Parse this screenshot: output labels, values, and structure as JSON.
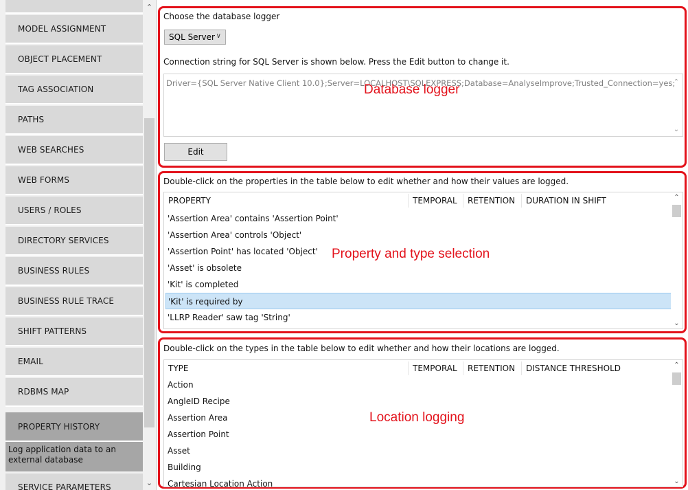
{
  "nav": {
    "items": [
      {
        "label": "MODEL ASSIGNMENT"
      },
      {
        "label": "OBJECT PLACEMENT"
      },
      {
        "label": "TAG ASSOCIATION"
      },
      {
        "label": "PATHS"
      },
      {
        "label": "WEB SEARCHES"
      },
      {
        "label": "WEB FORMS"
      },
      {
        "label": "USERS / ROLES"
      },
      {
        "label": "DIRECTORY SERVICES"
      },
      {
        "label": "BUSINESS RULES"
      },
      {
        "label": "BUSINESS RULE TRACE"
      },
      {
        "label": "SHIFT PATTERNS"
      },
      {
        "label": "EMAIL"
      },
      {
        "label": "RDBMS MAP"
      },
      {
        "label": "PROPERTY HISTORY"
      },
      {
        "label": "SERVICE PARAMETERS"
      }
    ],
    "active_index": 13,
    "active_description": "Log application data to an external database"
  },
  "logger": {
    "heading": "Choose the database logger",
    "selected": "SQL Server",
    "info": "Connection string for SQL Server is shown below. Press the Edit button to change it.",
    "connection_string": "Driver={SQL Server Native Client 10.0};Server=LOCALHOST\\SQLEXPRESS;Database=AnalyseImprove;Trusted_Connection=yes;",
    "edit_label": "Edit",
    "annotation": "Database  logger"
  },
  "properties": {
    "heading": "Double-click on the properties in the table below to edit whether and how their values are logged.",
    "columns": [
      "PROPERTY",
      "TEMPORAL",
      "RETENTION",
      "DURATION IN SHIFT"
    ],
    "rows": [
      "'Assertion Area' contains 'Assertion Point'",
      "'Assertion Area' controls 'Object'",
      "'Assertion Point' has located 'Object'",
      "'Asset' is obsolete",
      "'Kit' is completed",
      "'Kit' is required by",
      "'LLRP Reader' saw tag 'String'"
    ],
    "selected_index": 5,
    "annotation": "Property and type selection"
  },
  "types": {
    "heading": "Double-click on the types in the table below to edit whether and how their locations are logged.",
    "columns": [
      "TYPE",
      "TEMPORAL",
      "RETENTION",
      "DISTANCE THRESHOLD"
    ],
    "rows": [
      "Action",
      "AngleID Recipe",
      "Assertion Area",
      "Assertion Point",
      "Asset",
      "Building",
      "Cartesian Location Action"
    ],
    "annotation": "Location logging"
  },
  "colors": {
    "annotation_red": "#e3121b",
    "nav_item": "#d9d9d9",
    "nav_active": "#a6a6a6",
    "selection": "#cce4f7"
  }
}
